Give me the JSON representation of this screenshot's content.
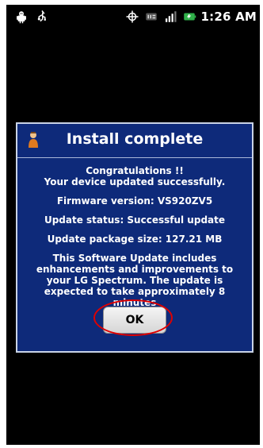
{
  "status_bar": {
    "time": "1:26 AM",
    "left_icons": [
      "android-debug-icon",
      "usb-icon"
    ],
    "right_icons": [
      "gps-icon",
      "lte-4g-icon",
      "signal-bars-icon",
      "battery-charging-icon"
    ]
  },
  "dialog": {
    "title": "Install complete",
    "message_lines": [
      "Congratulations !!",
      "Your device updated successfully.",
      "Firmware version: VS920ZV5",
      "Update status: Successful update",
      "Update package size: 127.21 MB",
      "This Software Update includes enhancements and improvements to your LG Spectrum. The update is expected to take approximately 8 minutes"
    ],
    "ok_label": "OK"
  },
  "colors": {
    "screen_bg": "#000000",
    "dialog_bg": "#0e2a7a",
    "dialog_border": "#c9d3e6",
    "text": "#ffffff",
    "highlight_ring": "#e00000"
  }
}
